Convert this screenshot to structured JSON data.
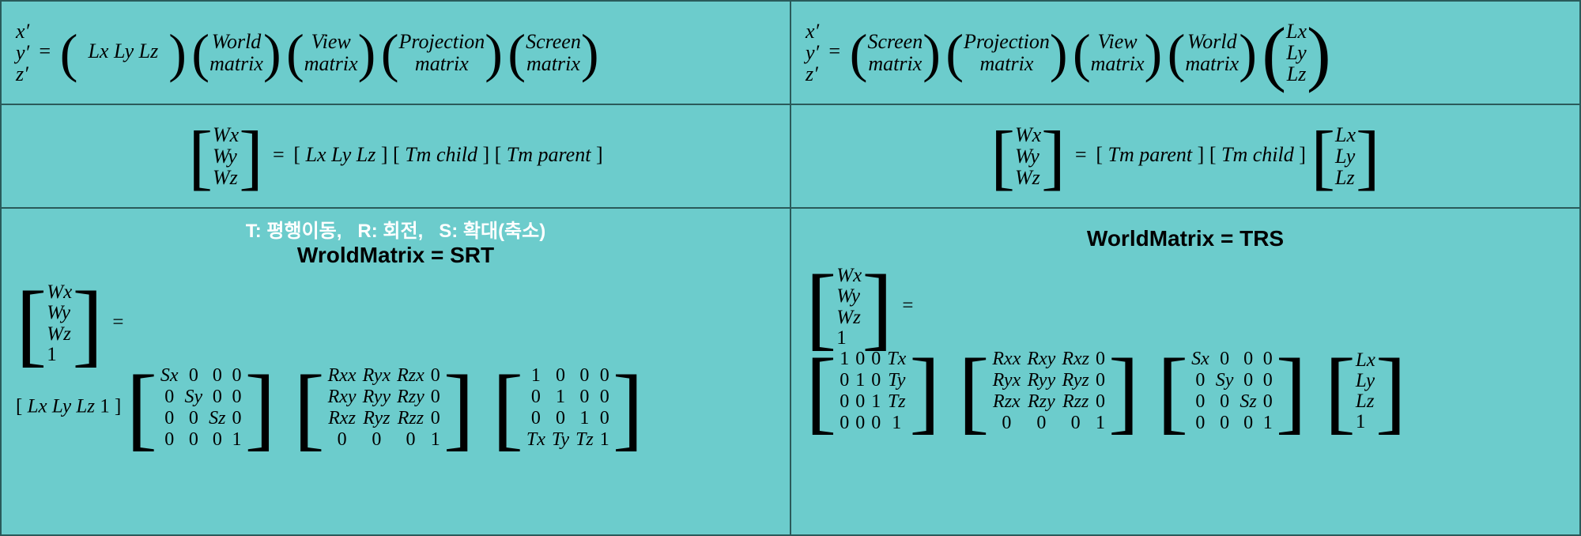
{
  "labels": {
    "xprime": "x′",
    "yprime": "y′",
    "zprime": "z′",
    "eq": "=",
    "Lx": "Lx",
    "Ly": "Ly",
    "Lz": "Lz",
    "Wx": "Wx",
    "Wy": "Wy",
    "Wz": "Wz",
    "one": "1",
    "World": "World",
    "matrix": "matrix",
    "View": "View",
    "Projection": "Projection",
    "Screen": "Screen",
    "Tm_child": "Tm child",
    "Tm_parent": "Tm parent",
    "legend": "T: 평행이동,   R: 회전,   S: 확대(축소)",
    "wm_srt": "WroldMatrix = SRT",
    "wm_trs": "WorldMatrix = TRS"
  },
  "Smat_row": [
    [
      "Sx",
      "0",
      "0",
      "0"
    ],
    [
      "0",
      "Sy",
      "0",
      "0"
    ],
    [
      "0",
      "0",
      "Sz",
      "0"
    ],
    [
      "0",
      "0",
      "0",
      "1"
    ]
  ],
  "R_rowmajor": [
    [
      "Rxx",
      "Ryx",
      "Rzx",
      "0"
    ],
    [
      "Rxy",
      "Ryy",
      "Rzy",
      "0"
    ],
    [
      "Rxz",
      "Ryz",
      "Rzz",
      "0"
    ],
    [
      "0",
      "0",
      "0",
      "1"
    ]
  ],
  "T_rowmajor": [
    [
      "1",
      "0",
      "0",
      "0"
    ],
    [
      "0",
      "1",
      "0",
      "0"
    ],
    [
      "0",
      "0",
      "1",
      "0"
    ],
    [
      "Tx",
      "Ty",
      "Tz",
      "1"
    ]
  ],
  "T_colmajor": [
    [
      "1",
      "0",
      "0",
      "Tx"
    ],
    [
      "0",
      "1",
      "0",
      "Ty"
    ],
    [
      "0",
      "0",
      "1",
      "Tz"
    ],
    [
      "0",
      "0",
      "0",
      "1"
    ]
  ],
  "R_colmajor": [
    [
      "Rxx",
      "Rxy",
      "Rxz",
      "0"
    ],
    [
      "Ryx",
      "Ryy",
      "Ryz",
      "0"
    ],
    [
      "Rzx",
      "Rzy",
      "Rzz",
      "0"
    ],
    [
      "0",
      "0",
      "0",
      "1"
    ]
  ],
  "Smat_col": [
    [
      "Sx",
      "0",
      "0",
      "0"
    ],
    [
      "0",
      "Sy",
      "0",
      "0"
    ],
    [
      "0",
      "0",
      "Sz",
      "0"
    ],
    [
      "0",
      "0",
      "0",
      "1"
    ]
  ],
  "Lvec4": [
    "Lx",
    "Ly",
    "Lz",
    "1"
  ],
  "Wvec4": [
    "Wx",
    "Wy",
    "Wz",
    "1"
  ]
}
